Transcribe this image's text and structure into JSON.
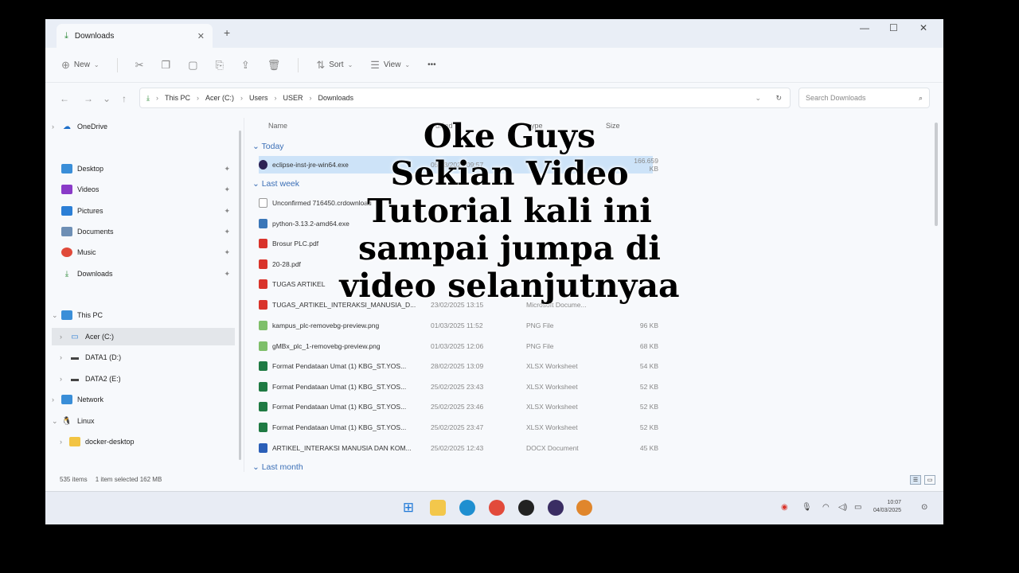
{
  "window": {
    "tab_label": "Downloads",
    "new_tab": "+",
    "controls": [
      "—",
      "☐",
      "✕"
    ]
  },
  "toolbar": {
    "new_label": "New",
    "sort_label": "Sort",
    "view_label": "View",
    "more_label": "•••"
  },
  "address": {
    "crumbs": [
      "This PC",
      "Acer (C:)",
      "Users",
      "USER",
      "Downloads"
    ],
    "search_placeholder": "Search Downloads"
  },
  "sidebar": {
    "onedrive": "OneDrive",
    "quick": [
      "Desktop",
      "Videos",
      "Pictures",
      "Documents",
      "Music",
      "Downloads"
    ],
    "this_pc": "This PC",
    "drives": [
      "Acer (C:)",
      "DATA1 (D:)",
      "DATA2 (E:)"
    ],
    "network": "Network",
    "linux": "Linux",
    "docker": "docker-desktop"
  },
  "columns": {
    "name": "Name",
    "modified": "dified",
    "type": "ype",
    "size": "Size"
  },
  "groups": {
    "today": "Today",
    "last_week": "Last week",
    "last_month": "Last month"
  },
  "files": [
    {
      "name": "eclipse-inst-jre-win64.exe",
      "date": "05/03/2025 09:57",
      "type": "",
      "size": "166.659 KB"
    },
    {
      "name": "Unconfirmed 716450.crdownload",
      "date": "",
      "type": "",
      "size": ""
    },
    {
      "name": "python-3.13.2-amd64.exe",
      "date": "",
      "type": "",
      "size": ""
    },
    {
      "name": "Brosur PLC.pdf",
      "date": "",
      "type": "",
      "size": ""
    },
    {
      "name": "20-28.pdf",
      "date": "",
      "type": "",
      "size": ""
    },
    {
      "name": "TUGAS ARTIKEL",
      "date": "",
      "type": "",
      "size": ""
    },
    {
      "name": "TUGAS_ARTIKEL_INTERAKSI_MANUSIA_D...",
      "date": "23/02/2025 13:15",
      "type": "Microsoft Docume...",
      "size": ""
    },
    {
      "name": "kampus_plc-removebg-preview.png",
      "date": "01/03/2025 11:52",
      "type": "PNG File",
      "size": "96 KB"
    },
    {
      "name": "gMBx_plc_1-removebg-preview.png",
      "date": "01/03/2025 12:06",
      "type": "PNG File",
      "size": "68 KB"
    },
    {
      "name": "Format Pendataan Umat (1) KBG_ST.YOS...",
      "date": "28/02/2025 13:09",
      "type": "XLSX Worksheet",
      "size": "54 KB"
    },
    {
      "name": "Format Pendataan Umat (1) KBG_ST.YOS...",
      "date": "25/02/2025 23:43",
      "type": "XLSX Worksheet",
      "size": "52 KB"
    },
    {
      "name": "Format Pendataan Umat (1) KBG_ST.YOS...",
      "date": "25/02/2025 23:46",
      "type": "XLSX Worksheet",
      "size": "52 KB"
    },
    {
      "name": "Format Pendataan Umat (1) KBG_ST.YOS...",
      "date": "25/02/2025 23:47",
      "type": "XLSX Worksheet",
      "size": "52 KB"
    },
    {
      "name": "ARTIKEL_INTERAKSI MANUSIA DAN KOM...",
      "date": "25/02/2025 12:43",
      "type": "DOCX Document",
      "size": "45 KB"
    }
  ],
  "status": {
    "items": "535 items",
    "selected": "1 item selected  162 MB"
  },
  "clock": {
    "time": "10:07",
    "date": "04/03/2025"
  },
  "caption": {
    "line1": "Oke Guys",
    "line2": "Sekian Video",
    "line3": "Tutorial kali ini",
    "line4": "sampai jumpa di",
    "line5": "video selanjutnyaa"
  },
  "colors": {
    "selection": "#cde3f8",
    "group_header": "#3b6fb6",
    "taskbar": "#e8ecf4"
  }
}
